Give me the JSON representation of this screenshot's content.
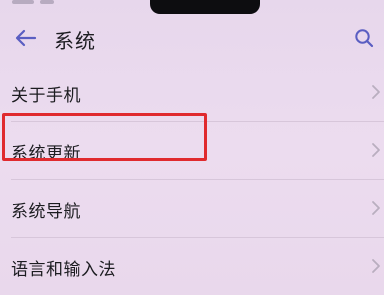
{
  "header": {
    "title": "系统",
    "back_icon": "arrow-left-icon",
    "search_icon": "search-icon"
  },
  "settings_list": {
    "items": [
      {
        "label": "关于手机",
        "chevron_icon": "chevron-right-icon"
      },
      {
        "label": "系统更新",
        "chevron_icon": "chevron-right-icon"
      },
      {
        "label": "系统导航",
        "chevron_icon": "chevron-right-icon"
      },
      {
        "label": "语言和输入法",
        "chevron_icon": "chevron-right-icon"
      }
    ]
  },
  "annotation": {
    "highlighted_item": "系统更新",
    "highlight_color": "#e02a2e"
  },
  "colors": {
    "accent": "#5a5ec2",
    "background": "#ebdcef",
    "text": "#1b1b1e"
  }
}
